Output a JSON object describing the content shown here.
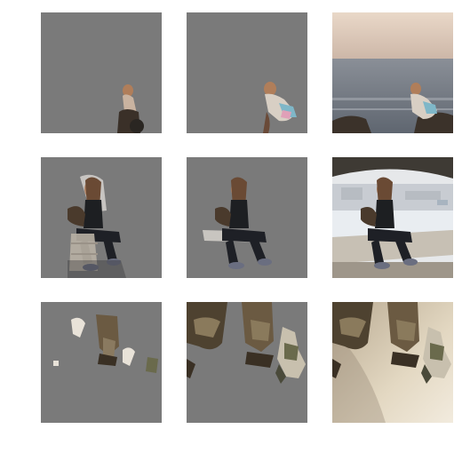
{
  "figure": {
    "background_color": "#ffffff",
    "mask_fill_color": "#7a7a7a",
    "rows": [
      {
        "subject": "person-crouching-on-rocks-by-sea",
        "panels": [
          {
            "kind": "masked-crop",
            "id": "row1-mask-a"
          },
          {
            "kind": "masked-crop",
            "id": "row1-mask-b"
          },
          {
            "kind": "full-photo",
            "id": "row1-photo"
          }
        ]
      },
      {
        "subject": "woman-sitting-on-concrete-ledge",
        "panels": [
          {
            "kind": "masked-crop",
            "id": "row2-mask-a"
          },
          {
            "kind": "masked-crop",
            "id": "row2-mask-b"
          },
          {
            "kind": "full-photo",
            "id": "row2-photo"
          }
        ]
      },
      {
        "subject": "legs-in-boots-and-skydiver-over-sand",
        "panels": [
          {
            "kind": "masked-crop",
            "id": "row3-mask-a"
          },
          {
            "kind": "masked-crop",
            "id": "row3-mask-b"
          },
          {
            "kind": "full-photo",
            "id": "row3-photo"
          }
        ]
      }
    ]
  }
}
